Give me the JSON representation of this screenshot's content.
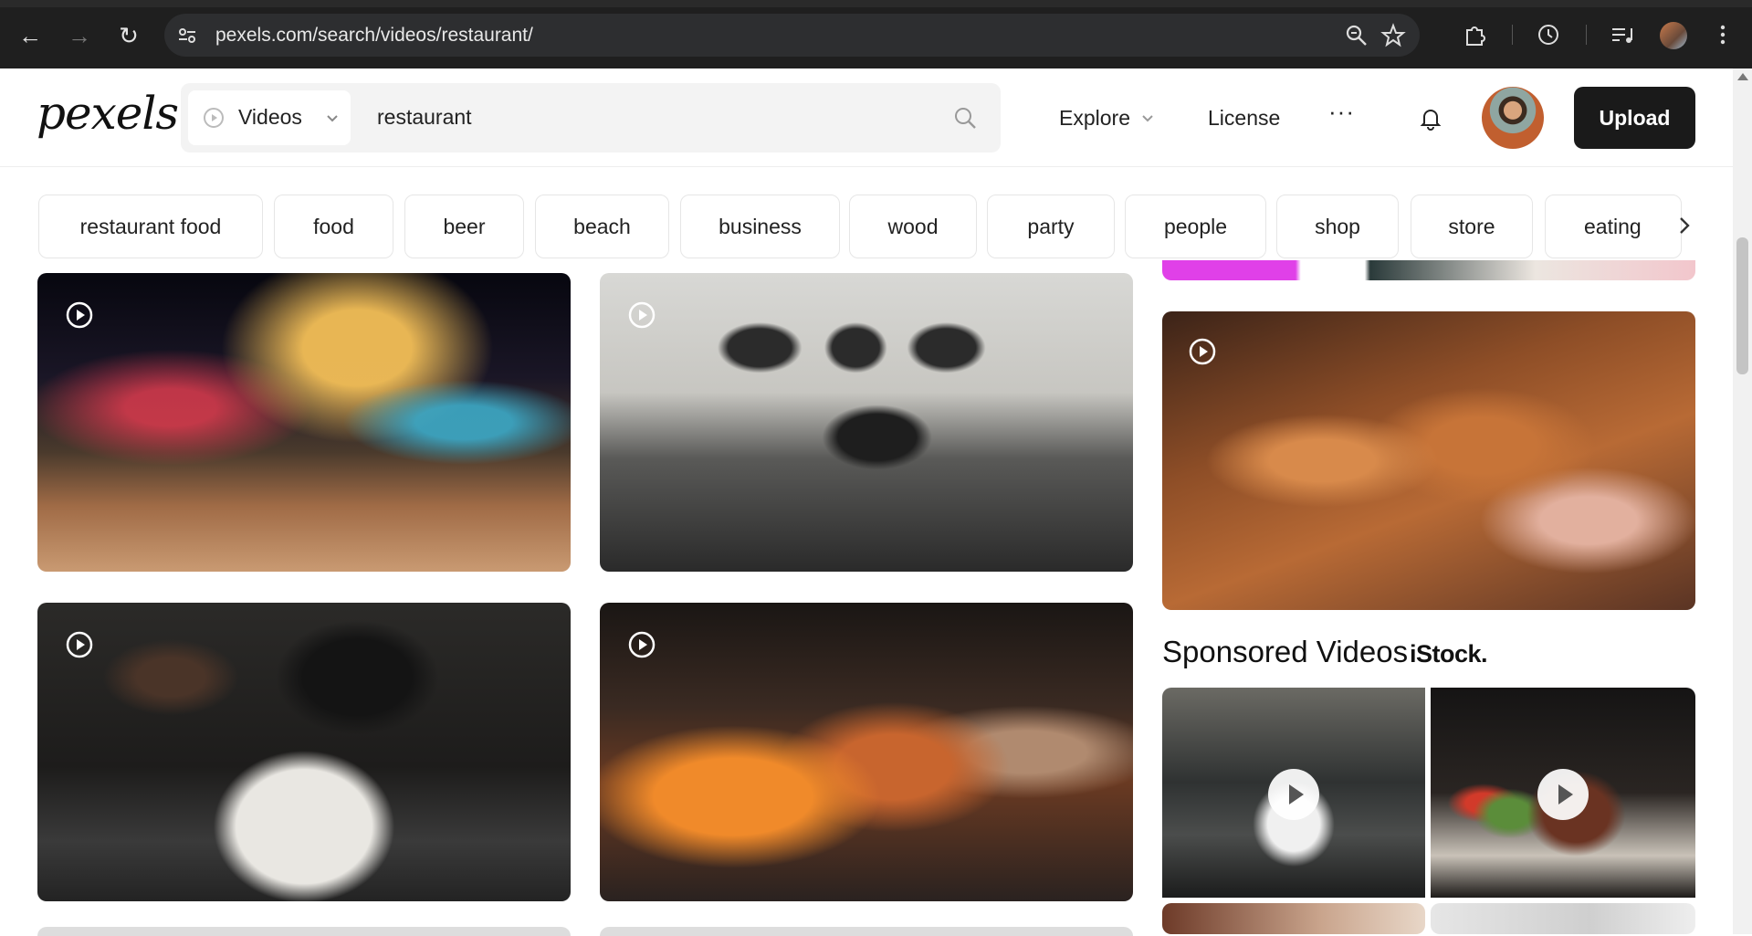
{
  "browser": {
    "url": "pexels.com/search/videos/restaurant/"
  },
  "header": {
    "logo": "pexels",
    "search": {
      "type_label": "Videos",
      "query": "restaurant"
    },
    "nav": {
      "explore": "Explore",
      "license": "License",
      "more": "···"
    },
    "upload_label": "Upload"
  },
  "chips": [
    "restaurant food",
    "food",
    "beer",
    "beach",
    "business",
    "wood",
    "party",
    "people",
    "shop",
    "store",
    "eating"
  ],
  "sponsored": {
    "title": "Sponsored Videos",
    "brand": "iStock."
  },
  "colors": {
    "chrome_bg": "#1f1f1f",
    "upload_bg": "#1a1a1a",
    "chip_border": "#e6e6e6"
  }
}
